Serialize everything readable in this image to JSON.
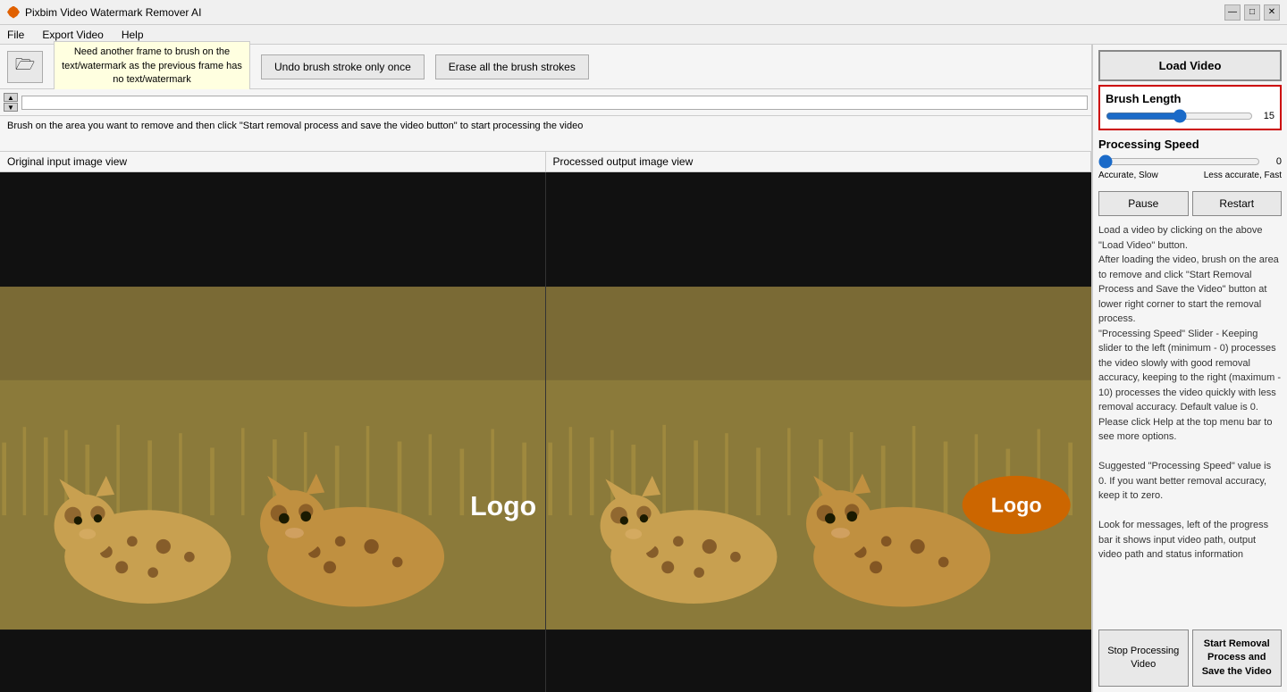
{
  "app": {
    "title": "Pixbim Video Watermark Remover AI",
    "icon": "pixbim-icon"
  },
  "titlebar": {
    "minimize": "—",
    "maximize": "□",
    "close": "✕"
  },
  "menu": {
    "items": [
      "File",
      "Export Video",
      "Help"
    ]
  },
  "toolbar": {
    "folder_icon": "📁",
    "tooltip": "Need another frame to brush on the text/watermark as the previous frame has no text/watermark",
    "undo_btn": "Undo brush stroke only once",
    "erase_btn": "Erase all the brush strokes"
  },
  "instruction": {
    "text": "Brush on the area you want to remove and then click \"Start removal process and save the video button\" to start processing the video"
  },
  "image_views": {
    "left_label": "Original input image view",
    "right_label": "Processed output image view"
  },
  "logo_left": "Logo",
  "logo_right": "Logo",
  "right_panel": {
    "load_video": "Load Video",
    "brush_length_title": "Brush Length",
    "brush_length_value": 15,
    "brush_length_min": 0,
    "brush_length_max": 30,
    "processing_speed_title": "Processing Speed",
    "processing_speed_value": 0,
    "processing_speed_min": 0,
    "processing_speed_max": 10,
    "speed_label_left": "Accurate, Slow",
    "speed_label_right": "Less accurate, Fast",
    "pause_btn": "Pause",
    "restart_btn": "Restart",
    "info_text": "Load a video by clicking on the above \"Load Video\" button.\nAfter loading the video, brush on the area to remove and click \"Start Removal Process and Save the Video\" button at lower right corner to start the removal process.\n\"Processing Speed\" Slider - Keeping slider to the left (minimum - 0) processes the video slowly with good removal accuracy, keeping to the right (maximum - 10) processes the video quickly with less removal accuracy. Default value is 0.\nPlease click Help at the top menu bar to see more options.\n\nSuggested \"Processing Speed\" value is 0. If you want better removal accuracy, keep it to zero.\n\nLook for messages, left of the progress bar it shows input video path, output video path and status information",
    "stop_btn": "Stop Processing Video",
    "start_removal_btn": "Start Removal Process and Save the Video"
  }
}
